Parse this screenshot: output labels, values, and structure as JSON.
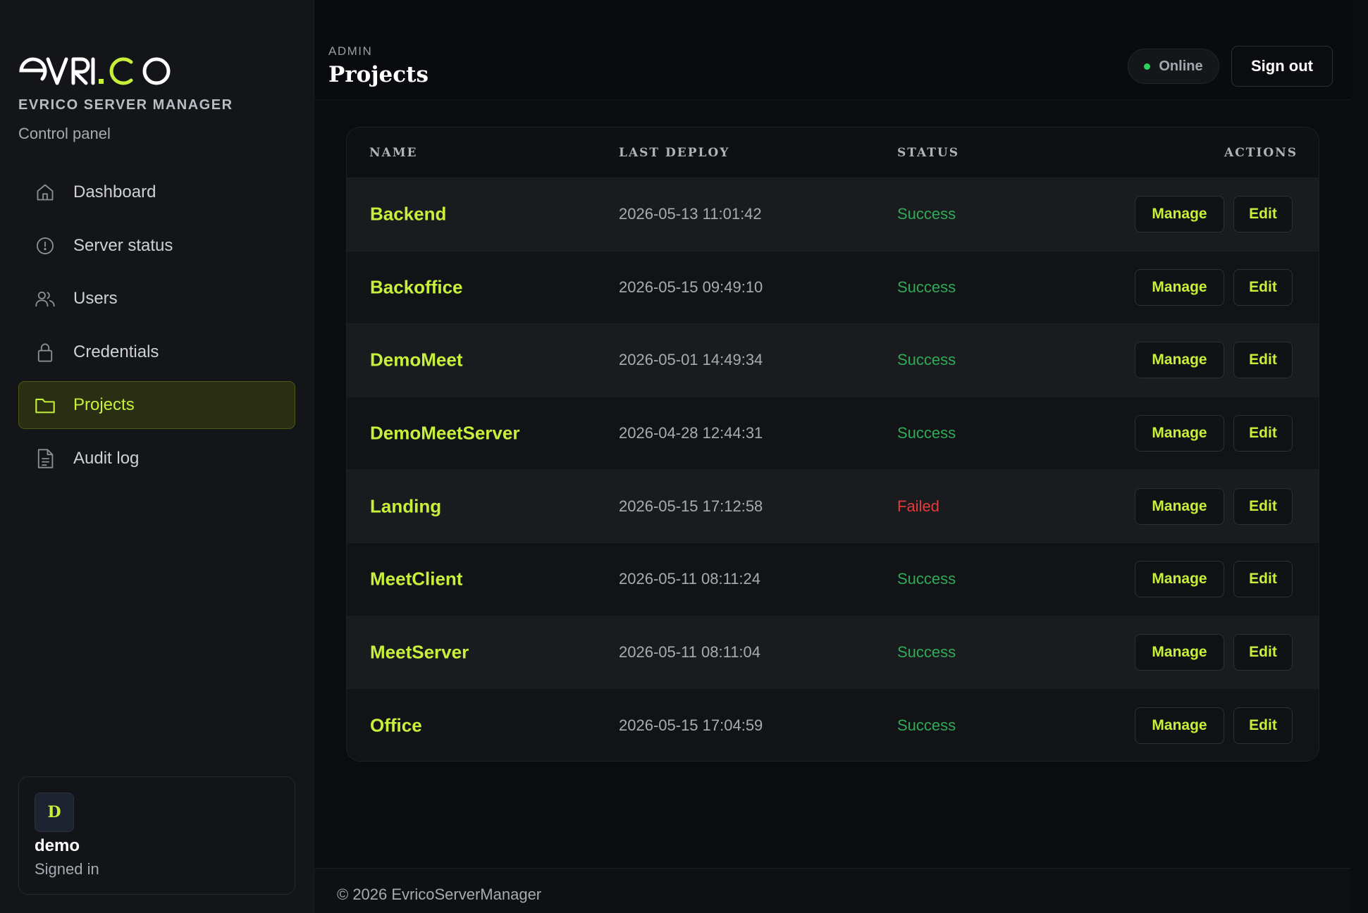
{
  "brand": {
    "logo_text": "evri.co",
    "title": "EVRICO SERVER MANAGER",
    "subtitle": "Control panel"
  },
  "sidebar": {
    "items": [
      {
        "label": "Dashboard",
        "icon": "home-icon",
        "active": false
      },
      {
        "label": "Server status",
        "icon": "status-circle-icon",
        "active": false
      },
      {
        "label": "Users",
        "icon": "users-icon",
        "active": false
      },
      {
        "label": "Credentials",
        "icon": "lock-icon",
        "active": false
      },
      {
        "label": "Projects",
        "icon": "folder-icon",
        "active": true
      },
      {
        "label": "Audit log",
        "icon": "document-icon",
        "active": false
      }
    ]
  },
  "user": {
    "initial": "D",
    "name": "demo",
    "status": "Signed in"
  },
  "header": {
    "eyebrow": "ADMIN",
    "title": "Projects",
    "status_label": "Online",
    "sign_out_label": "Sign out"
  },
  "table": {
    "columns": [
      "NAME",
      "LAST DEPLOY",
      "STATUS",
      "ACTIONS"
    ],
    "manage_label": "Manage",
    "edit_label": "Edit",
    "rows": [
      {
        "name": "Backend",
        "last_deploy": "2026-05-13 11:01:42",
        "status": "Success"
      },
      {
        "name": "Backoffice",
        "last_deploy": "2026-05-15 09:49:10",
        "status": "Success"
      },
      {
        "name": "DemoMeet",
        "last_deploy": "2026-05-01 14:49:34",
        "status": "Success"
      },
      {
        "name": "DemoMeetServer",
        "last_deploy": "2026-04-28 12:44:31",
        "status": "Success"
      },
      {
        "name": "Landing",
        "last_deploy": "2026-05-15 17:12:58",
        "status": "Failed"
      },
      {
        "name": "MeetClient",
        "last_deploy": "2026-05-11 08:11:24",
        "status": "Success"
      },
      {
        "name": "MeetServer",
        "last_deploy": "2026-05-11 08:11:04",
        "status": "Success"
      },
      {
        "name": "Office",
        "last_deploy": "2026-05-15 17:04:59",
        "status": "Success"
      }
    ]
  },
  "footer": {
    "text": "© 2026 EvricoServerManager"
  },
  "colors": {
    "accent": "#c8f03a",
    "success": "#2eab57",
    "failed": "#e23b3b",
    "online_dot": "#2ed25e"
  }
}
